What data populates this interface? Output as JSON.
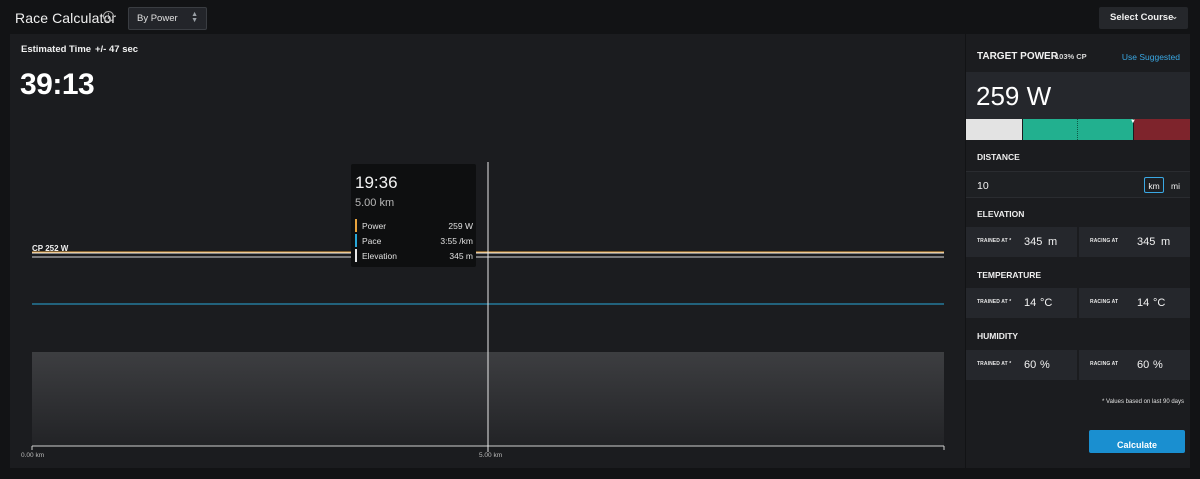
{
  "header": {
    "title": "Race Calculator",
    "info_icon": "info-icon",
    "mode_select_value": "By Power",
    "select_course_label": "Select Course"
  },
  "estimate": {
    "label": "Estimated Time",
    "margin": "+/- 47 sec",
    "time": "39:13"
  },
  "chart_data": {
    "type": "line",
    "xlabel": "",
    "ylabel": "",
    "x_ticks": [
      "0.00 km",
      "5.00 km"
    ],
    "xlim": [
      0,
      10
    ],
    "cp_label": "CP 252 W",
    "series": [
      {
        "name": "Power",
        "color": "#e8a33d",
        "x": [
          0,
          10
        ],
        "values": [
          259,
          259
        ]
      },
      {
        "name": "Pace",
        "color": "#29a7d8",
        "x": [
          0,
          10
        ],
        "values": [
          "3:55 /km",
          "3:55 /km"
        ]
      },
      {
        "name": "Elevation",
        "color": "#d9d9d9",
        "x": [
          0,
          10
        ],
        "values": [
          345,
          345
        ]
      }
    ],
    "cursor": {
      "x_km": 5.0,
      "time": "19:36",
      "distance": "5.00 km",
      "rows": [
        {
          "label": "Power",
          "value": "259 W",
          "color": "#e8a33d"
        },
        {
          "label": "Pace",
          "value": "3:55 /km",
          "color": "#29a7d8"
        },
        {
          "label": "Elevation",
          "value": "345 m",
          "color": "#e8e8e8"
        }
      ]
    }
  },
  "target_power": {
    "title": "TARGET POWER",
    "cp_percent": "103% CP",
    "use_suggested": "Use Suggested",
    "value": "259 W",
    "zones": [
      {
        "color": "#e3e3e3"
      },
      {
        "color": "#22b08f"
      },
      {
        "color": "#7e242c"
      }
    ],
    "marker_fraction": 0.75
  },
  "distance": {
    "label": "DISTANCE",
    "value": "10",
    "unit_km": "km",
    "unit_mi": "mi",
    "selected_unit": "km"
  },
  "elevation": {
    "label": "ELEVATION",
    "trained_label": "TRAINED AT *",
    "trained_value": "345",
    "racing_label": "RACING AT",
    "racing_value": "345",
    "unit": "m"
  },
  "temperature": {
    "label": "TEMPERATURE",
    "trained_label": "TRAINED AT *",
    "trained_value": "14",
    "racing_label": "RACING AT",
    "racing_value": "14",
    "unit": "°C"
  },
  "humidity": {
    "label": "HUMIDITY",
    "trained_label": "TRAINED AT *",
    "trained_value": "60",
    "racing_label": "RACING AT",
    "racing_value": "60",
    "unit": "%"
  },
  "footnote": "* Values based on last 90 days",
  "calculate_label": "Calculate",
  "colors": {
    "accent": "#3aa8e4",
    "button": "#1a8fd0",
    "power": "#e8a33d",
    "pace": "#29a7d8"
  }
}
